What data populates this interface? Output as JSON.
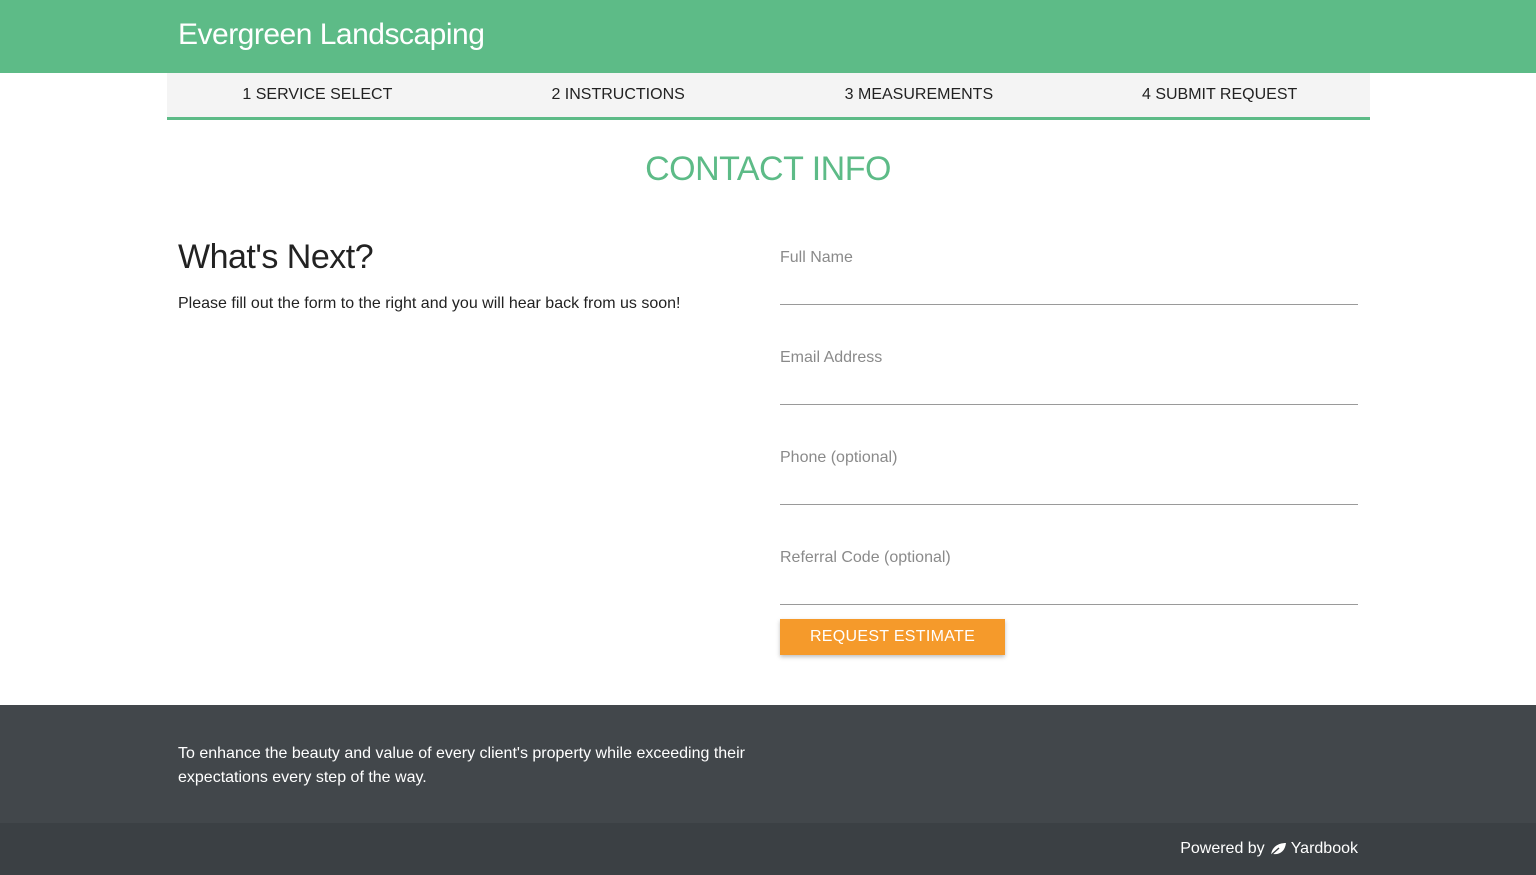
{
  "header": {
    "brand": "Evergreen Landscaping"
  },
  "steps": [
    {
      "label": "1 SERVICE SELECT"
    },
    {
      "label": "2 INSTRUCTIONS"
    },
    {
      "label": "3 MEASUREMENTS"
    },
    {
      "label": "4 SUBMIT REQUEST"
    }
  ],
  "main": {
    "title": "CONTACT INFO",
    "next_heading": "What's Next?",
    "next_text": "Please fill out the form to the right and you will hear back from us soon!"
  },
  "form": {
    "full_name": {
      "placeholder": "Full Name",
      "value": ""
    },
    "email": {
      "placeholder": "Email Address",
      "value": ""
    },
    "phone": {
      "placeholder": "Phone (optional)",
      "value": ""
    },
    "referral": {
      "placeholder": "Referral Code (optional)",
      "value": ""
    },
    "submit_label": "REQUEST ESTIMATE"
  },
  "footer": {
    "mission": "To enhance the beauty and value of every client's property while exceeding their expectations every step of the way.",
    "powered_by": "Powered by",
    "powered_brand": "Yardbook",
    "powered_icon": "leaf-icon"
  },
  "colors": {
    "brand_green": "#5dbb87",
    "accent_orange": "#f59a2b",
    "footer_dark": "#42474b"
  }
}
